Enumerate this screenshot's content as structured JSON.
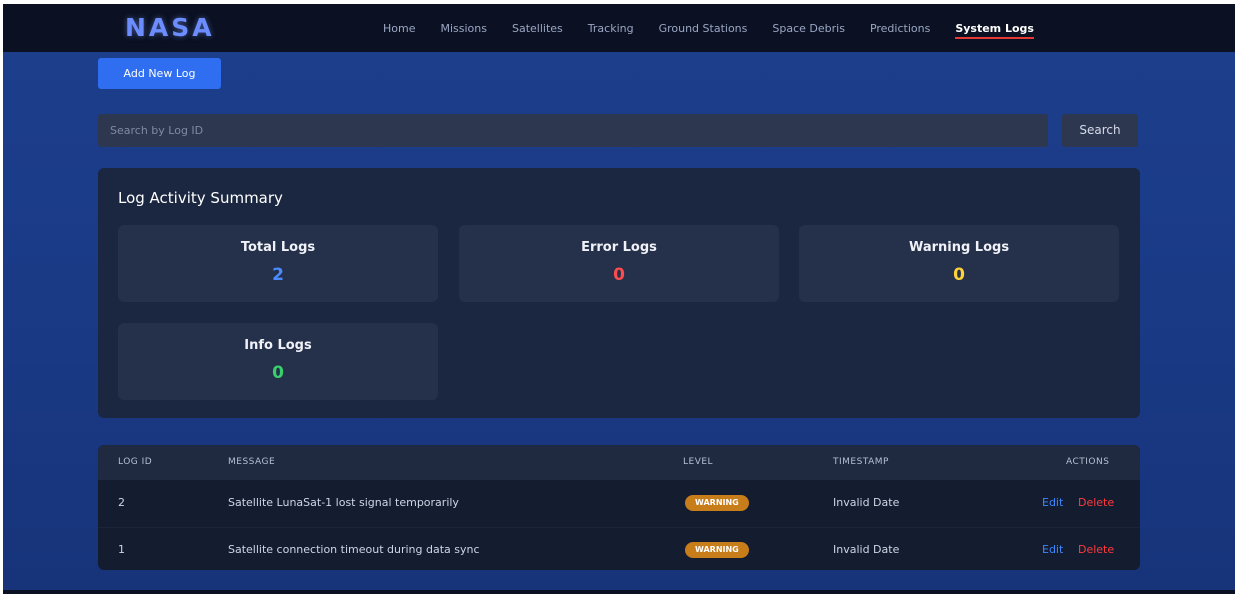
{
  "brand": {
    "logo": "NASA"
  },
  "nav": {
    "items": [
      {
        "label": "Home"
      },
      {
        "label": "Missions"
      },
      {
        "label": "Satellites"
      },
      {
        "label": "Tracking"
      },
      {
        "label": "Ground Stations"
      },
      {
        "label": "Space Debris"
      },
      {
        "label": "Predictions"
      },
      {
        "label": "System Logs"
      }
    ],
    "active": "System Logs"
  },
  "toolbar": {
    "add_label": "Add New Log"
  },
  "search": {
    "placeholder": "Search by Log ID",
    "button_label": "Search"
  },
  "summary": {
    "title": "Log Activity Summary",
    "cards": [
      {
        "label": "Total Logs",
        "value": "2",
        "color": "#4a8cff"
      },
      {
        "label": "Error Logs",
        "value": "0",
        "color": "#ff4d4d"
      },
      {
        "label": "Warning Logs",
        "value": "0",
        "color": "#ffd23a"
      },
      {
        "label": "Info Logs",
        "value": "0",
        "color": "#38d06b"
      }
    ]
  },
  "table": {
    "headers": {
      "id": "LOG ID",
      "message": "MESSAGE",
      "level": "LEVEL",
      "timestamp": "TIMESTAMP",
      "actions": "ACTIONS"
    },
    "rows": [
      {
        "id": "2",
        "message": "Satellite LunaSat-1 lost signal temporarily",
        "level": "WARNING",
        "timestamp": "Invalid Date",
        "edit": "Edit",
        "delete": "Delete"
      },
      {
        "id": "1",
        "message": "Satellite connection timeout during data sync",
        "level": "WARNING",
        "timestamp": "Invalid Date",
        "edit": "Edit",
        "delete": "Delete"
      }
    ]
  }
}
